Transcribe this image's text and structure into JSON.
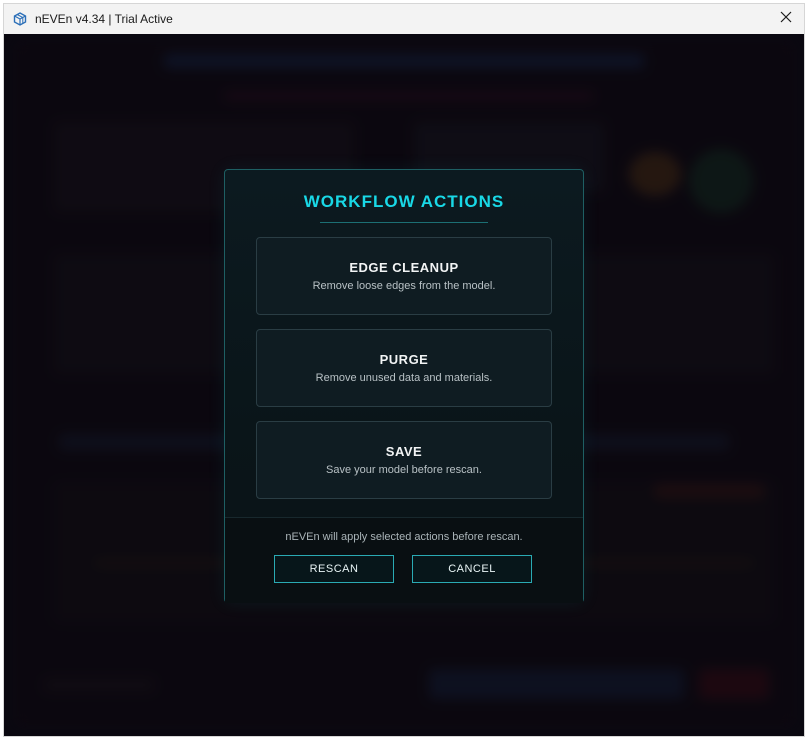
{
  "window": {
    "title": "nEVEn v4.34 | Trial Active"
  },
  "modal": {
    "title": "WORKFLOW ACTIONS",
    "actions": [
      {
        "title": "EDGE CLEANUP",
        "description": "Remove loose edges from the model."
      },
      {
        "title": "PURGE",
        "description": "Remove unused data and materials."
      },
      {
        "title": "SAVE",
        "description": "Save your model before rescan."
      }
    ],
    "footer_note": "nEVEn will apply selected actions before rescan.",
    "rescan_label": "RESCAN",
    "cancel_label": "CANCEL"
  },
  "colors": {
    "accent": "#19d8e6",
    "modal_border": "#1e5f63",
    "background": "#0e0c14"
  },
  "icons": {
    "app": "cube-icon",
    "close": "close-icon"
  }
}
